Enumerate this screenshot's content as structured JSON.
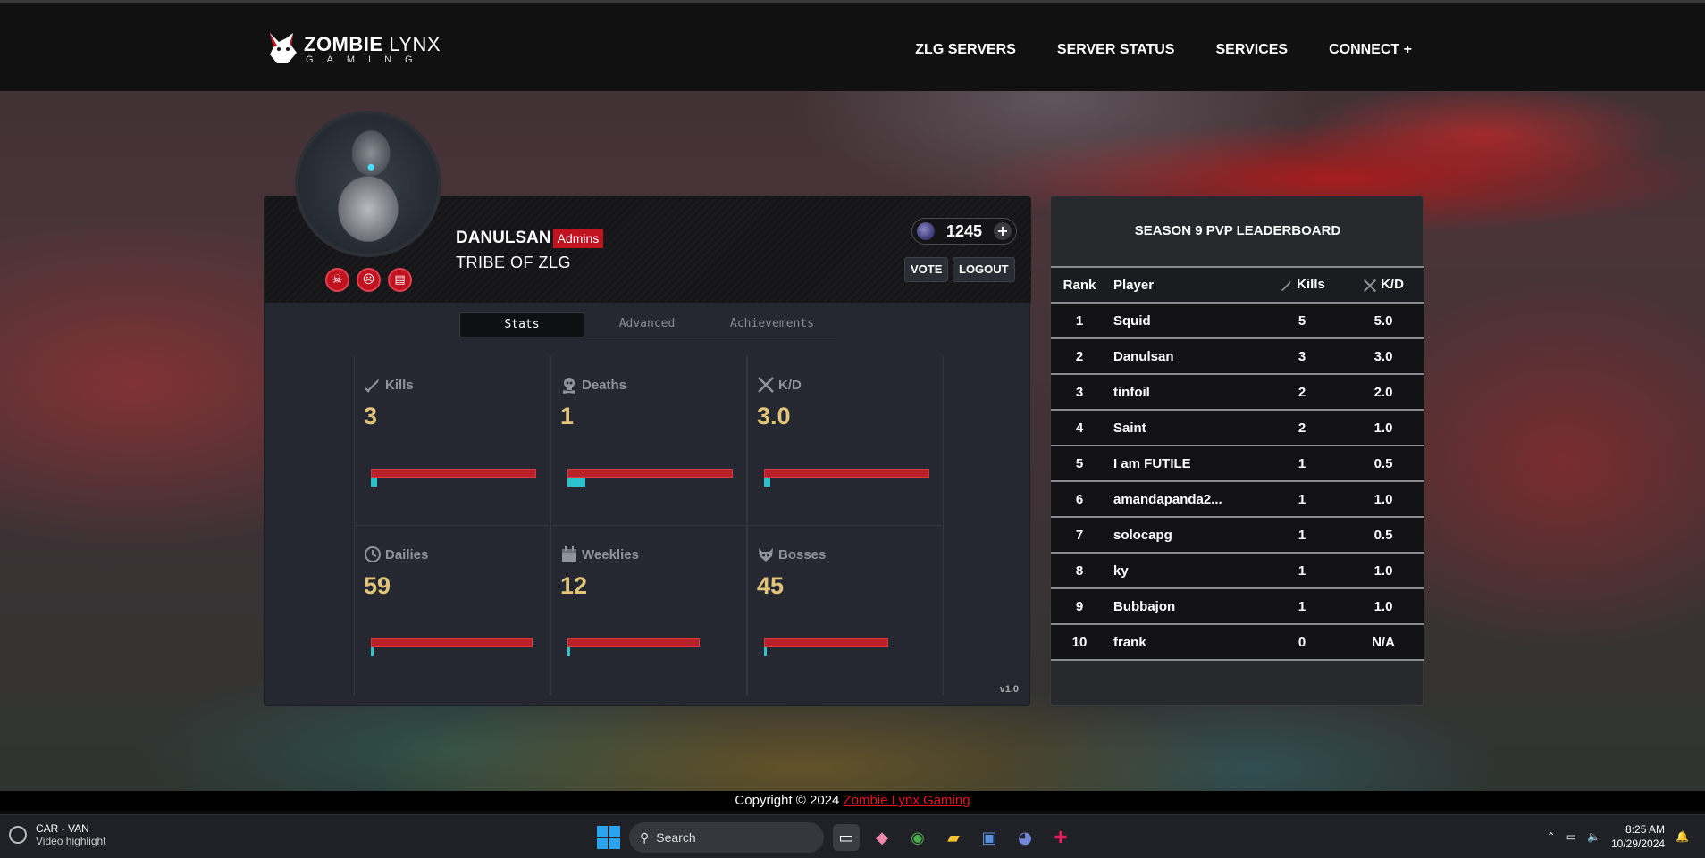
{
  "header": {
    "logo_word1_bold": "ZOMBIE",
    "logo_word1_thin": "LYNX",
    "logo_word2": "GAMING",
    "nav": [
      "ZLG SERVERS",
      "SERVER STATUS",
      "SERVICES",
      "CONNECT +"
    ]
  },
  "profile": {
    "username": "DANULSAN",
    "role": "Admins",
    "tribe": "TRIBE OF ZLG",
    "points": "1245",
    "vote_label": "VOTE",
    "logout_label": "LOGOUT",
    "badges": [
      "skull-badge-icon",
      "zombie-badge-icon",
      "calendar-badge-icon"
    ],
    "tabs": [
      {
        "label": "Stats",
        "active": true
      },
      {
        "label": "Advanced",
        "active": false
      },
      {
        "label": "Achievements",
        "active": false
      }
    ],
    "stats": [
      {
        "label": "Kills",
        "value": "3",
        "icon": "sword-icon",
        "fill": 0.04,
        "track": 1.0
      },
      {
        "label": "Deaths",
        "value": "1",
        "icon": "skull-icon",
        "fill": 0.11,
        "track": 1.0
      },
      {
        "label": "K/D",
        "value": "3.0",
        "icon": "crossed-swords-icon",
        "fill": 0.04,
        "track": 1.0
      },
      {
        "label": "Dailies",
        "value": "59",
        "icon": "clock-icon",
        "fill": 0.01,
        "track": 0.98
      },
      {
        "label": "Weeklies",
        "value": "12",
        "icon": "calendar-icon",
        "fill": 0.01,
        "track": 0.8
      },
      {
        "label": "Bosses",
        "value": "45",
        "icon": "boss-icon",
        "fill": 0.01,
        "track": 0.75
      }
    ],
    "version": "v1.0"
  },
  "leaderboard": {
    "title": "SEASON 9 PVP LEADERBOARD",
    "columns": [
      "Rank",
      "Player",
      "Kills",
      "K/D"
    ],
    "rows": [
      [
        "1",
        "Squid",
        "5",
        "5.0"
      ],
      [
        "2",
        "Danulsan",
        "3",
        "3.0"
      ],
      [
        "3",
        "tinfoil",
        "2",
        "2.0"
      ],
      [
        "4",
        "Saint",
        "2",
        "1.0"
      ],
      [
        "5",
        "I am FUTILE",
        "1",
        "0.5"
      ],
      [
        "6",
        "amandapanda2...",
        "1",
        "1.0"
      ],
      [
        "7",
        "solocapg",
        "1",
        "0.5"
      ],
      [
        "8",
        "ky",
        "1",
        "1.0"
      ],
      [
        "9",
        "Bubbajon",
        "1",
        "1.0"
      ],
      [
        "10",
        "frank",
        "0",
        "N/A"
      ]
    ]
  },
  "footer": {
    "prefix": "Copyright © 2024",
    "brand": "Zombie Lynx Gaming"
  },
  "taskbar": {
    "news_title": "CAR - VAN",
    "news_sub": "Video highlight",
    "search_placeholder": "Search",
    "time": "8:25 AM",
    "date": "10/29/2024"
  },
  "colors": {
    "accent_red": "#c0121f",
    "stat_value": "#e2c57a",
    "bar_fill": "#2ac3cc",
    "footer_brand": "#e8151d"
  }
}
